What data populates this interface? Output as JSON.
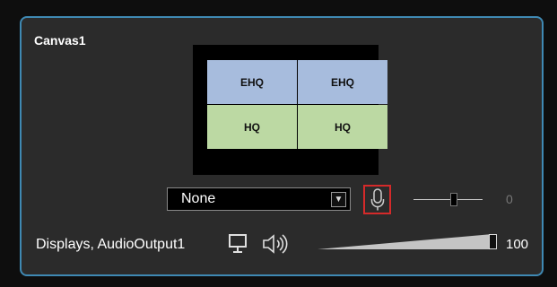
{
  "canvas": {
    "title": "Canvas1",
    "tiles": [
      {
        "label": "EHQ",
        "type": "ehq"
      },
      {
        "label": "EHQ",
        "type": "ehq"
      },
      {
        "label": "HQ",
        "type": "hq"
      },
      {
        "label": "HQ",
        "type": "hq"
      }
    ]
  },
  "audio_input": {
    "selected": "None",
    "dropdown_icon": "chevron-down-icon",
    "mic_icon": "microphone-icon",
    "level_value": "0",
    "level": 0.55
  },
  "output": {
    "label": "Displays, AudioOutput1",
    "display_icon": "monitor-icon",
    "speaker_icon": "speaker-icon",
    "volume_value": "100",
    "volume": 1.0
  },
  "colors": {
    "border": "#3f89b3",
    "ehq_tile": "#a7bcdd",
    "hq_tile": "#bcd9a3",
    "mic_highlight": "#d42a2a"
  }
}
